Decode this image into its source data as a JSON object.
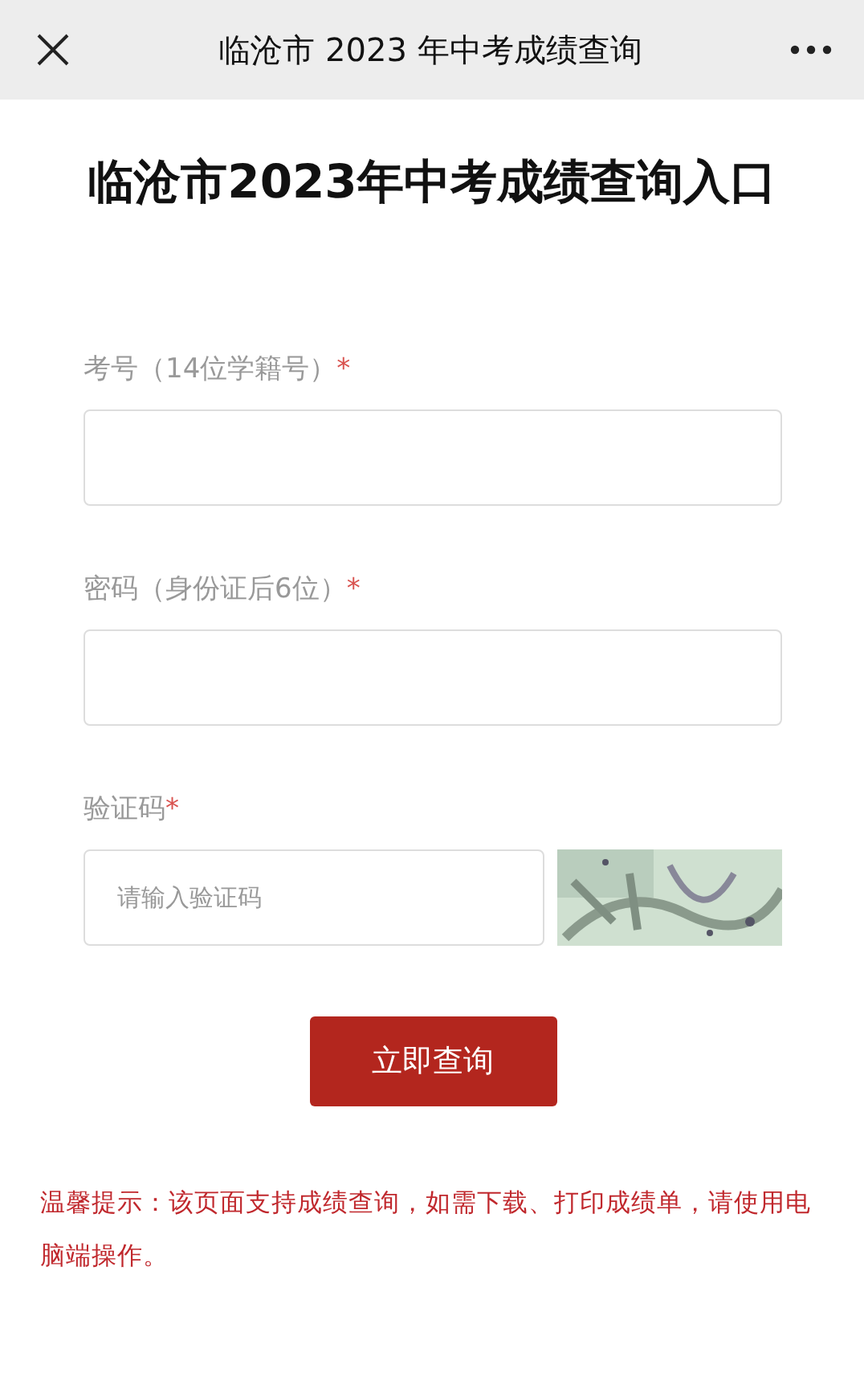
{
  "top_bar": {
    "title": "临沧市 2023 年中考成绩查询"
  },
  "heading": "临沧市2023年中考成绩查询入口",
  "fields": [
    {
      "kind": "text",
      "label": "考号（14位学籍号）",
      "required_mark": "*"
    },
    {
      "kind": "text",
      "label": "密码（身份证后6位）",
      "required_mark": "*"
    },
    {
      "kind": "captcha",
      "label": "验证码",
      "required_mark": "*",
      "placeholder": "请输入验证码"
    }
  ],
  "submit_button": "立即查询",
  "notice": "温馨提示：该页面支持成绩查询，如需下载、打印成绩单，请使用电脑端操作。"
}
